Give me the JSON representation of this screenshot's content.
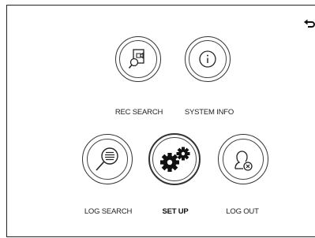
{
  "menu": {
    "back_icon": "return-arrow-icon",
    "items": [
      {
        "label": "REC SEARCH",
        "icon": "record-search-icon",
        "selected": false
      },
      {
        "label": "SYSTEM INFO",
        "icon": "info-icon",
        "selected": false
      },
      {
        "label": "LOG SEARCH",
        "icon": "log-search-icon",
        "selected": false
      },
      {
        "label": "SET UP",
        "icon": "gears-icon",
        "selected": true
      },
      {
        "label": "LOG OUT",
        "icon": "logout-user-icon",
        "selected": false
      }
    ]
  }
}
